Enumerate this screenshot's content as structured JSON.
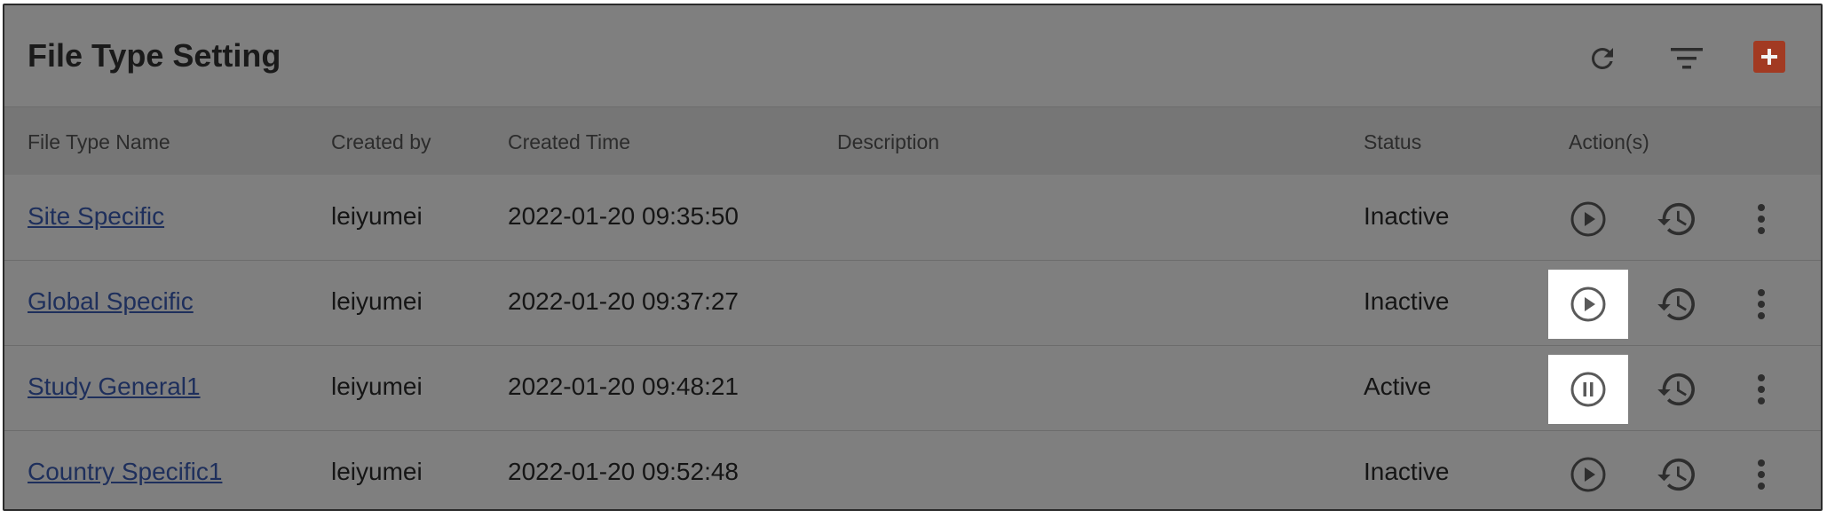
{
  "header": {
    "title": "File Type Setting",
    "icons": {
      "refresh": "refresh-icon",
      "filter": "filter-icon",
      "add": "add-icon"
    },
    "add_color": "#a23a22"
  },
  "table": {
    "columns": [
      "File Type Name",
      "Created by",
      "Created Time",
      "Description",
      "Status",
      "Action(s)"
    ],
    "rows": [
      {
        "name": "Site Specific",
        "created_by": "leiyumei",
        "created_time": "2022-01-20 09:35:50",
        "description": "",
        "status": "Inactive",
        "toggle_action": "play",
        "highlighted": false
      },
      {
        "name": "Global Specific",
        "created_by": "leiyumei",
        "created_time": "2022-01-20 09:37:27",
        "description": "",
        "status": "Inactive",
        "toggle_action": "play",
        "highlighted": true
      },
      {
        "name": "Study General1",
        "created_by": "leiyumei",
        "created_time": "2022-01-20 09:48:21",
        "description": "",
        "status": "Active",
        "toggle_action": "pause",
        "highlighted": true
      },
      {
        "name": "Country Specific1",
        "created_by": "leiyumei",
        "created_time": "2022-01-20 09:52:48",
        "description": "",
        "status": "Inactive",
        "toggle_action": "play",
        "highlighted": false
      }
    ]
  }
}
